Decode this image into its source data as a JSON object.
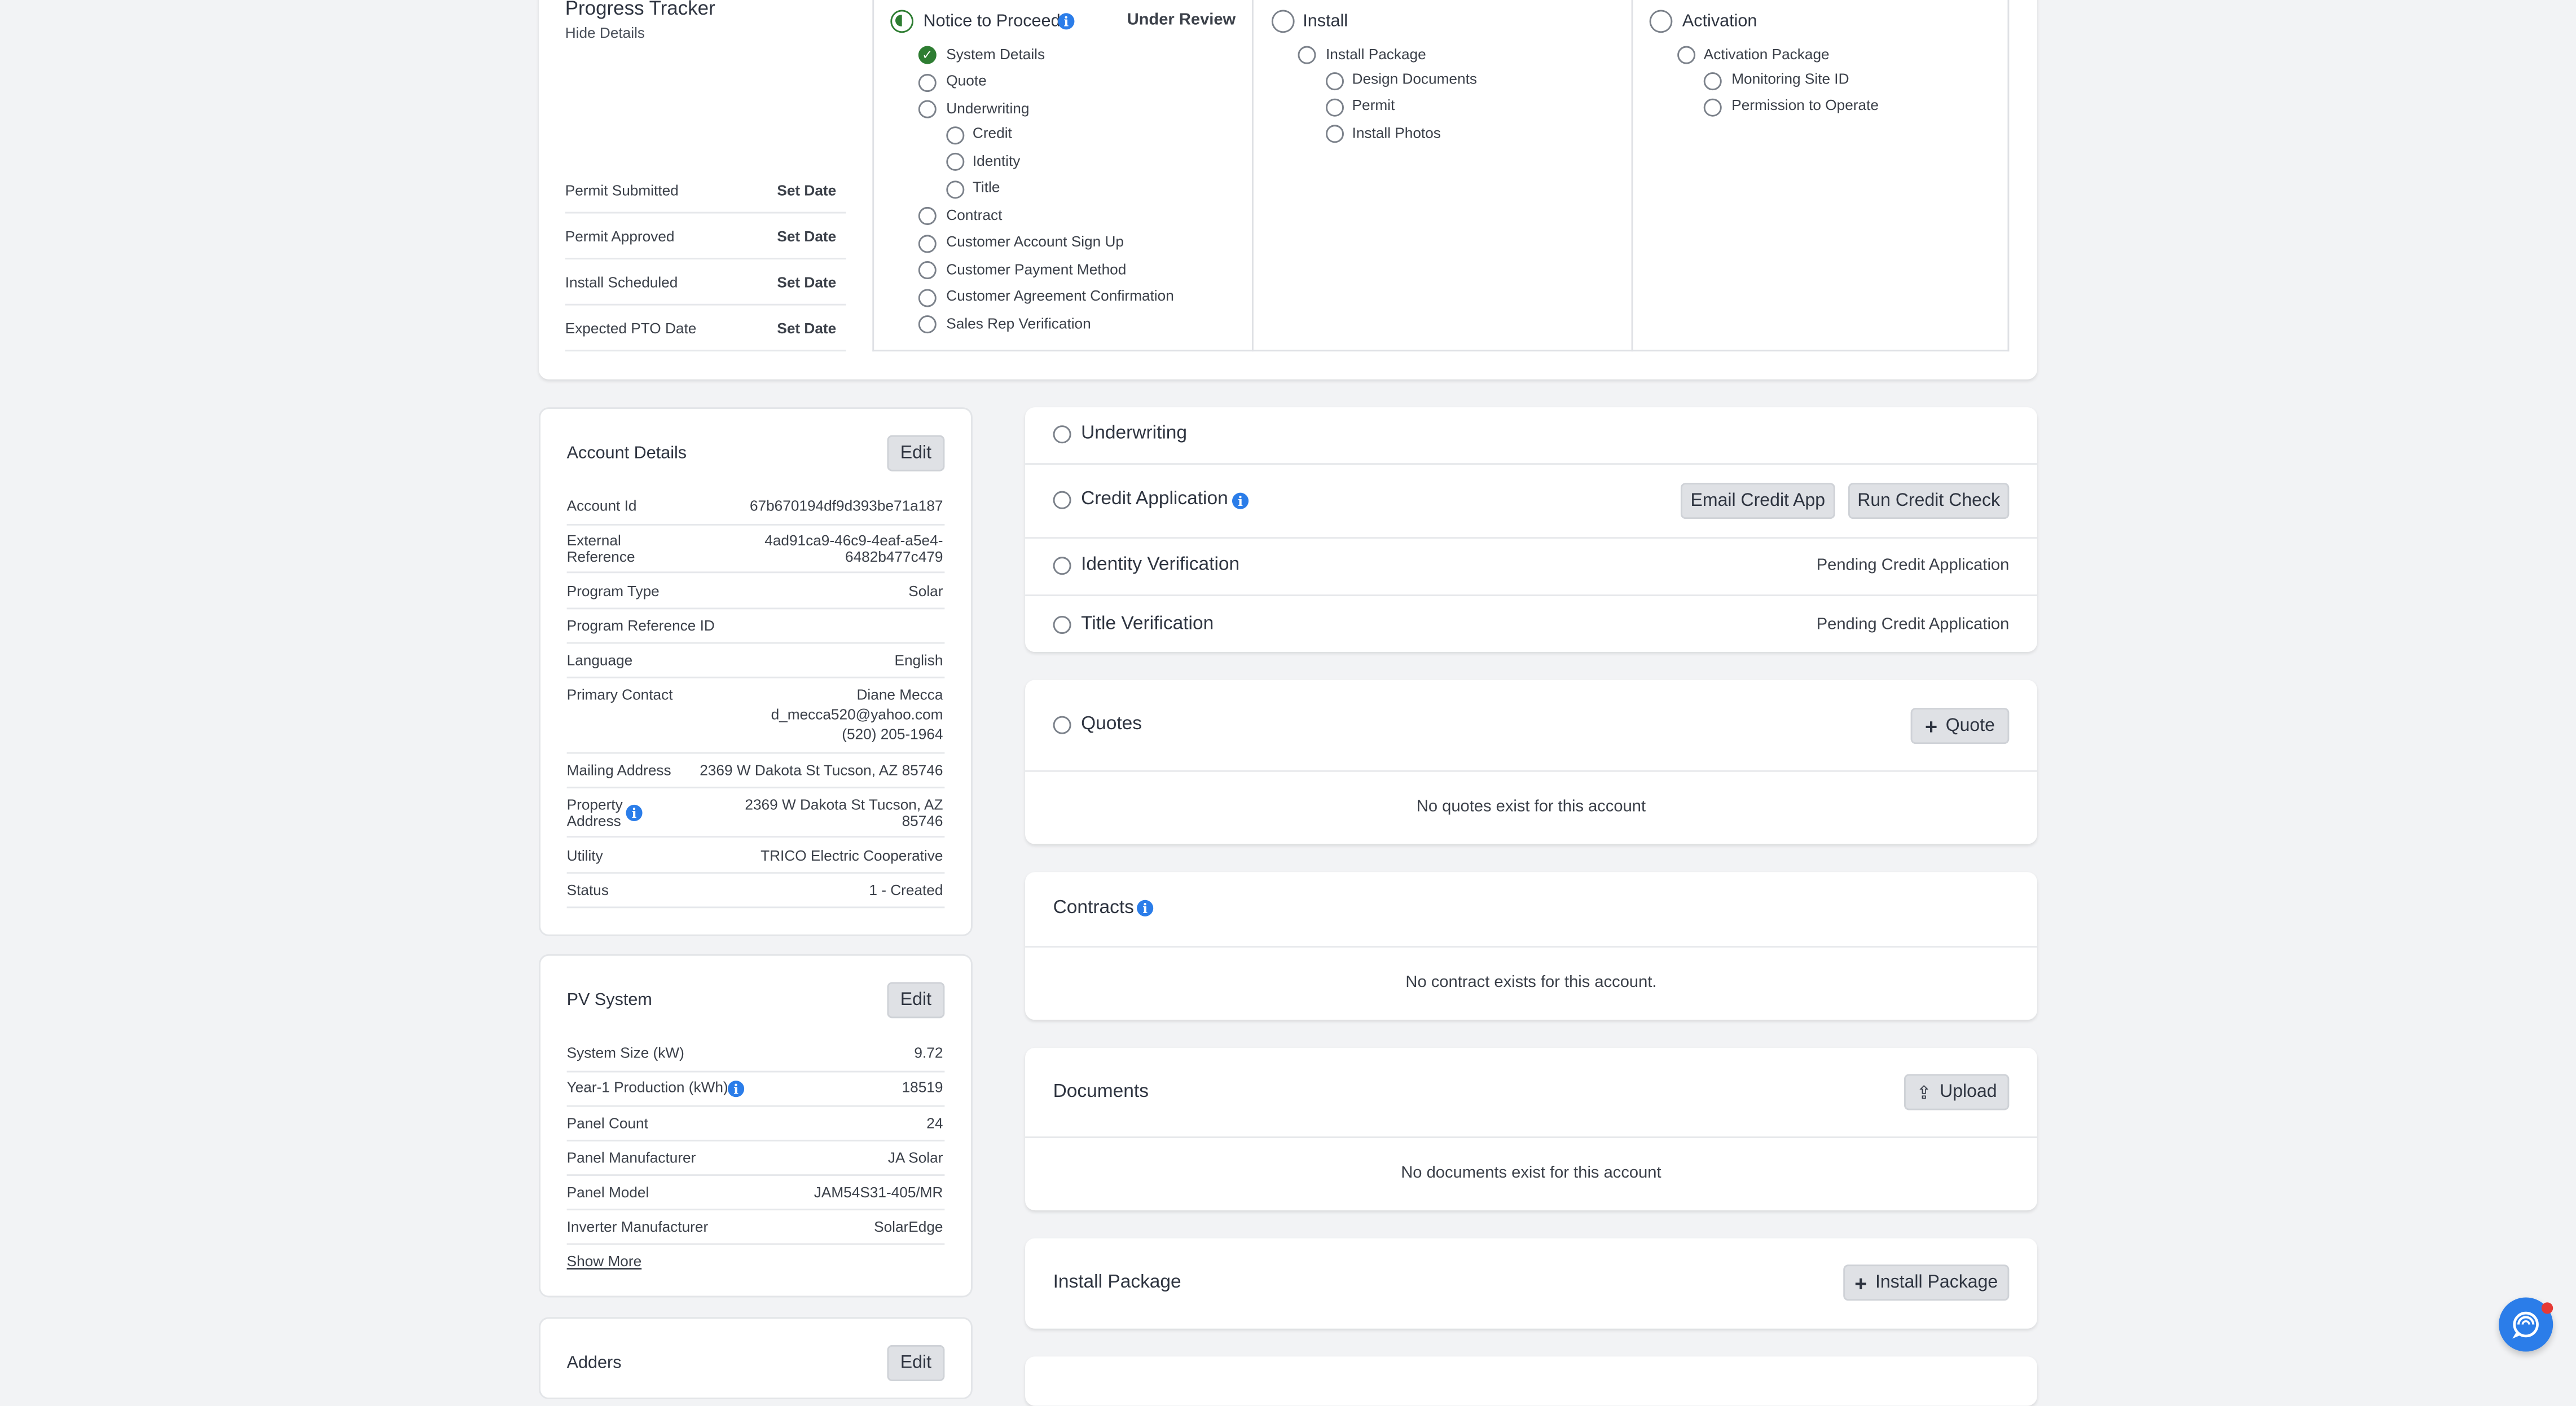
{
  "tracker": {
    "title": "Progress Tracker",
    "hide_details": "Hide Details",
    "dates": [
      {
        "label": "Permit Submitted",
        "action": "Set Date"
      },
      {
        "label": "Permit Approved",
        "action": "Set Date"
      },
      {
        "label": "Install Scheduled",
        "action": "Set Date"
      },
      {
        "label": "Expected PTO Date",
        "action": "Set Date"
      }
    ],
    "stages": [
      {
        "title": "Notice to Proceed",
        "status": "Under Review",
        "items": [
          {
            "label": "System Details",
            "done": true
          },
          {
            "label": "Quote"
          },
          {
            "label": "Underwriting"
          },
          {
            "label": "Credit"
          },
          {
            "label": "Identity"
          },
          {
            "label": "Title"
          },
          {
            "label": "Contract"
          },
          {
            "label": "Customer Account Sign Up"
          },
          {
            "label": "Customer Payment Method"
          },
          {
            "label": "Customer Agreement Confirmation"
          },
          {
            "label": "Sales Rep Verification"
          }
        ]
      },
      {
        "title": "Install",
        "items": [
          {
            "label": "Install Package"
          },
          {
            "label": "Design Documents"
          },
          {
            "label": "Permit"
          },
          {
            "label": "Install Photos"
          }
        ]
      },
      {
        "title": "Activation",
        "items": [
          {
            "label": "Activation Package"
          },
          {
            "label": "Monitoring Site ID"
          },
          {
            "label": "Permission to Operate"
          }
        ]
      }
    ]
  },
  "account": {
    "title": "Account Details",
    "edit": "Edit",
    "rows": [
      {
        "label": "Account Id",
        "value": "67b670194df9d393be71a187"
      },
      {
        "label1": "External",
        "label2": "Reference",
        "value1": "4ad91ca9-46c9-4eaf-a5e4-",
        "value2": "6482b477c479"
      },
      {
        "label": "Program Type",
        "value": "Solar"
      },
      {
        "label": "Program Reference ID",
        "value": ""
      },
      {
        "label": "Language",
        "value": "English"
      },
      {
        "label": "Primary Contact",
        "value1": "Diane Mecca",
        "value2": "d_mecca520@yahoo.com",
        "value3": "(520) 205-1964"
      },
      {
        "label": "Mailing Address",
        "value": "2369 W Dakota St Tucson, AZ 85746"
      },
      {
        "label1": "Property",
        "label2": "Address",
        "value1": "2369 W Dakota St Tucson, AZ",
        "value2": "85746"
      },
      {
        "label": "Utility",
        "value": "TRICO Electric Cooperative"
      },
      {
        "label": "Status",
        "value": "1 - Created"
      }
    ]
  },
  "pv": {
    "title": "PV System",
    "edit": "Edit",
    "rows": [
      {
        "label": "System Size (kW)",
        "value": "9.72"
      },
      {
        "label": "Year-1 Production (kWh)",
        "value": "18519"
      },
      {
        "label": "Panel Count",
        "value": "24"
      },
      {
        "label": "Panel Manufacturer",
        "value": "JA Solar"
      },
      {
        "label": "Panel Model",
        "value": "JAM54S31-405/MR"
      },
      {
        "label": "Inverter Manufacturer",
        "value": "SolarEdge"
      }
    ],
    "show_more": "Show More"
  },
  "adders": {
    "title": "Adders",
    "edit": "Edit"
  },
  "underwriting": {
    "title": "Underwriting",
    "credit_app": "Credit Application",
    "email_credit": "Email Credit App",
    "run_credit": "Run Credit Check",
    "identity": "Identity Verification",
    "identity_status": "Pending Credit Application",
    "title_verif": "Title Verification",
    "title_status": "Pending Credit Application"
  },
  "quotes": {
    "title": "Quotes",
    "add": "Quote",
    "empty": "No quotes exist for this account"
  },
  "contracts": {
    "title": "Contracts",
    "empty": "No contract exists for this account."
  },
  "documents": {
    "title": "Documents",
    "upload": "Upload",
    "empty": "No documents exist for this account"
  },
  "install_package": {
    "title": "Install Package",
    "add": "Install Package"
  },
  "colors": {
    "accent": "#2b7de9",
    "done": "#2e7d32",
    "chat": "#2b7de9",
    "badge": "#e53935"
  }
}
